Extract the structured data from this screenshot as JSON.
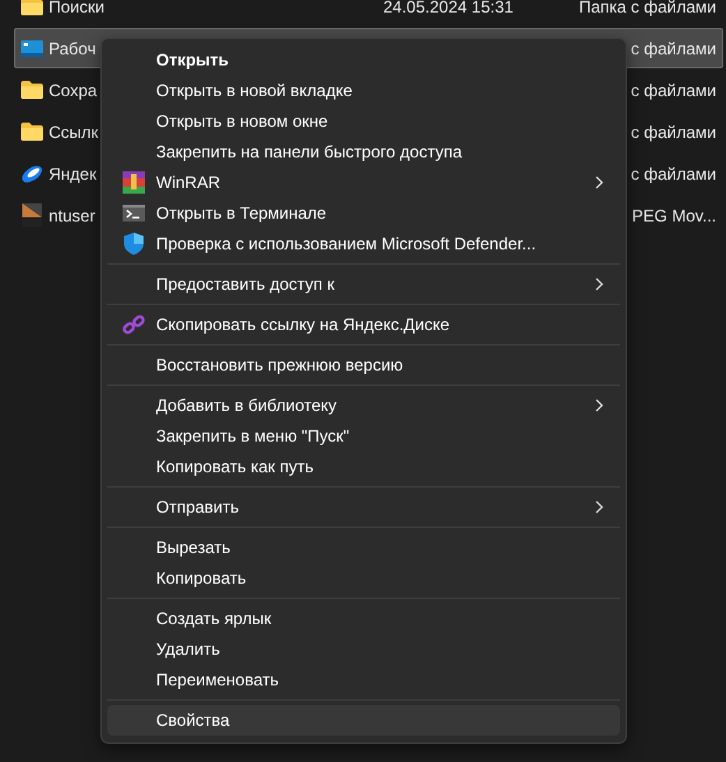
{
  "files": [
    {
      "kind": "folder",
      "name": "Поиски",
      "date": "24.05.2024 15:31",
      "type": "Папка с файлами",
      "selected": false
    },
    {
      "kind": "desktop",
      "name": "Рабоч",
      "type": "с файлами",
      "selected": true
    },
    {
      "kind": "folder",
      "name": "Сохра",
      "type": "с файлами",
      "selected": false
    },
    {
      "kind": "folder",
      "name": "Ссылк",
      "type": "с файлами",
      "selected": false
    },
    {
      "kind": "yandex",
      "name": "Яндек",
      "type": "с файлами",
      "selected": false
    },
    {
      "kind": "dat",
      "name": "ntuser",
      "type": "PEG Mov...",
      "selected": false
    }
  ],
  "menu": {
    "items": [
      {
        "kind": "item",
        "label": "Открыть",
        "default": true,
        "submenu": false,
        "hovered": false
      },
      {
        "kind": "item",
        "label": "Открыть в новой вкладке",
        "default": false,
        "submenu": false,
        "hovered": false
      },
      {
        "kind": "item",
        "label": "Открыть в новом окне",
        "default": false,
        "submenu": false,
        "hovered": false
      },
      {
        "kind": "item",
        "label": "Закрепить на панели быстрого доступа",
        "default": false,
        "submenu": false,
        "hovered": false
      },
      {
        "kind": "winrar",
        "label": "WinRAR",
        "default": false,
        "submenu": true,
        "hovered": false
      },
      {
        "kind": "terminal",
        "label": "Открыть в Терминале",
        "default": false,
        "submenu": false,
        "hovered": false
      },
      {
        "kind": "shield",
        "label": "Проверка с использованием Microsoft Defender...",
        "default": false,
        "submenu": false,
        "hovered": false
      },
      {
        "kind": "separator"
      },
      {
        "kind": "item",
        "label": "Предоставить доступ к",
        "default": false,
        "submenu": true,
        "hovered": false
      },
      {
        "kind": "separator"
      },
      {
        "kind": "link",
        "label": "Скопировать ссылку на Яндекс.Диске",
        "default": false,
        "submenu": false,
        "hovered": false
      },
      {
        "kind": "separator"
      },
      {
        "kind": "item",
        "label": "Восстановить прежнюю версию",
        "default": false,
        "submenu": false,
        "hovered": false
      },
      {
        "kind": "separator"
      },
      {
        "kind": "item",
        "label": "Добавить в библиотеку",
        "default": false,
        "submenu": true,
        "hovered": false
      },
      {
        "kind": "item",
        "label": "Закрепить в меню \"Пуск\"",
        "default": false,
        "submenu": false,
        "hovered": false
      },
      {
        "kind": "item",
        "label": "Копировать как путь",
        "default": false,
        "submenu": false,
        "hovered": false
      },
      {
        "kind": "separator"
      },
      {
        "kind": "item",
        "label": "Отправить",
        "default": false,
        "submenu": true,
        "hovered": false
      },
      {
        "kind": "separator"
      },
      {
        "kind": "item",
        "label": "Вырезать",
        "default": false,
        "submenu": false,
        "hovered": false
      },
      {
        "kind": "item",
        "label": "Копировать",
        "default": false,
        "submenu": false,
        "hovered": false
      },
      {
        "kind": "separator"
      },
      {
        "kind": "item",
        "label": "Создать ярлык",
        "default": false,
        "submenu": false,
        "hovered": false
      },
      {
        "kind": "item",
        "label": "Удалить",
        "default": false,
        "submenu": false,
        "hovered": false
      },
      {
        "kind": "item",
        "label": "Переименовать",
        "default": false,
        "submenu": false,
        "hovered": false
      },
      {
        "kind": "separator"
      },
      {
        "kind": "item",
        "label": "Свойства",
        "default": false,
        "submenu": false,
        "hovered": true
      }
    ]
  }
}
